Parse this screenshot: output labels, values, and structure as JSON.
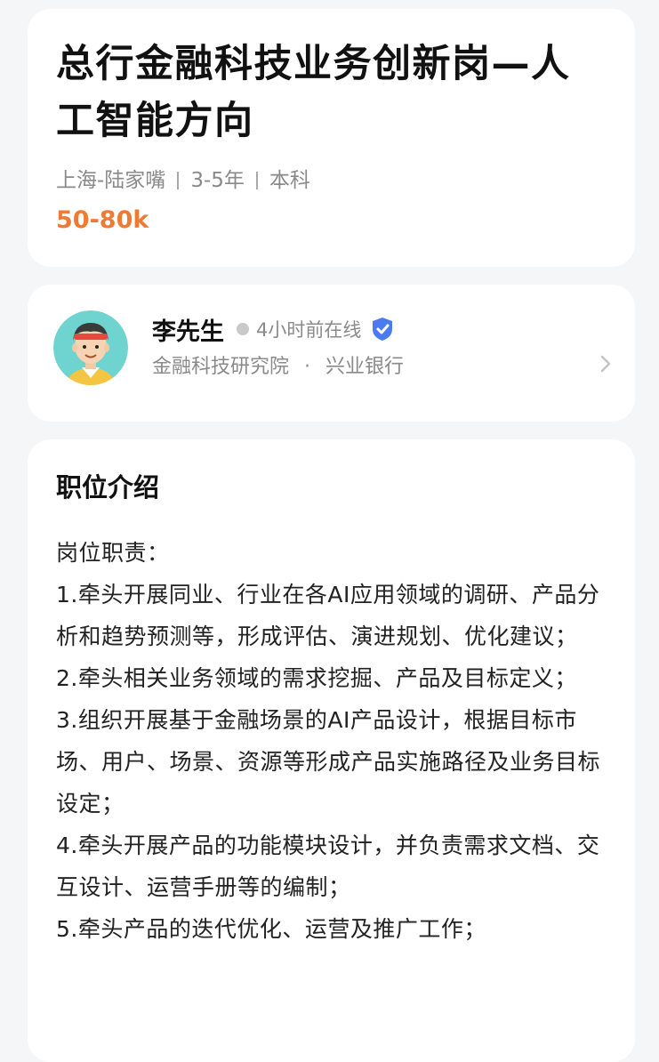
{
  "job": {
    "title": "总行金融科技业务创新岗—人工智能方向",
    "location": "上海-陆家嘴",
    "experience": "3-5年",
    "education": "本科",
    "salary": "50-80k"
  },
  "recruiter": {
    "avatar_icon": "avatar-cartoon-man-headband",
    "name": "李先生",
    "online_status": "4小时前在线",
    "verified_icon": "verified-shield-icon",
    "department": "金融科技研究院",
    "separator": "·",
    "company": "兴业银行",
    "chevron_icon": "chevron-right-icon"
  },
  "description": {
    "title": "职位介绍",
    "lines": [
      "岗位职责：",
      "1.牵头开展同业、行业在各AI应用领域的调研、产品分析和趋势预测等，形成评估、演进规划、优化建议；",
      "2.牵头相关业务领域的需求挖掘、产品及目标定义；",
      "3.组织开展基于金融场景的AI产品设计，根据目标市场、用户、场景、资源等形成产品实施路径及业务目标设定；",
      "4.牵头开展产品的功能模块设计，并负责需求文档、交互设计、运营手册等的编制；",
      "5.牵头产品的迭代优化、运营及推广工作；"
    ]
  },
  "colors": {
    "salary": "#ee7a34",
    "verified": "#4a7cf0",
    "background": "#f5f6f7",
    "card": "#ffffff"
  }
}
